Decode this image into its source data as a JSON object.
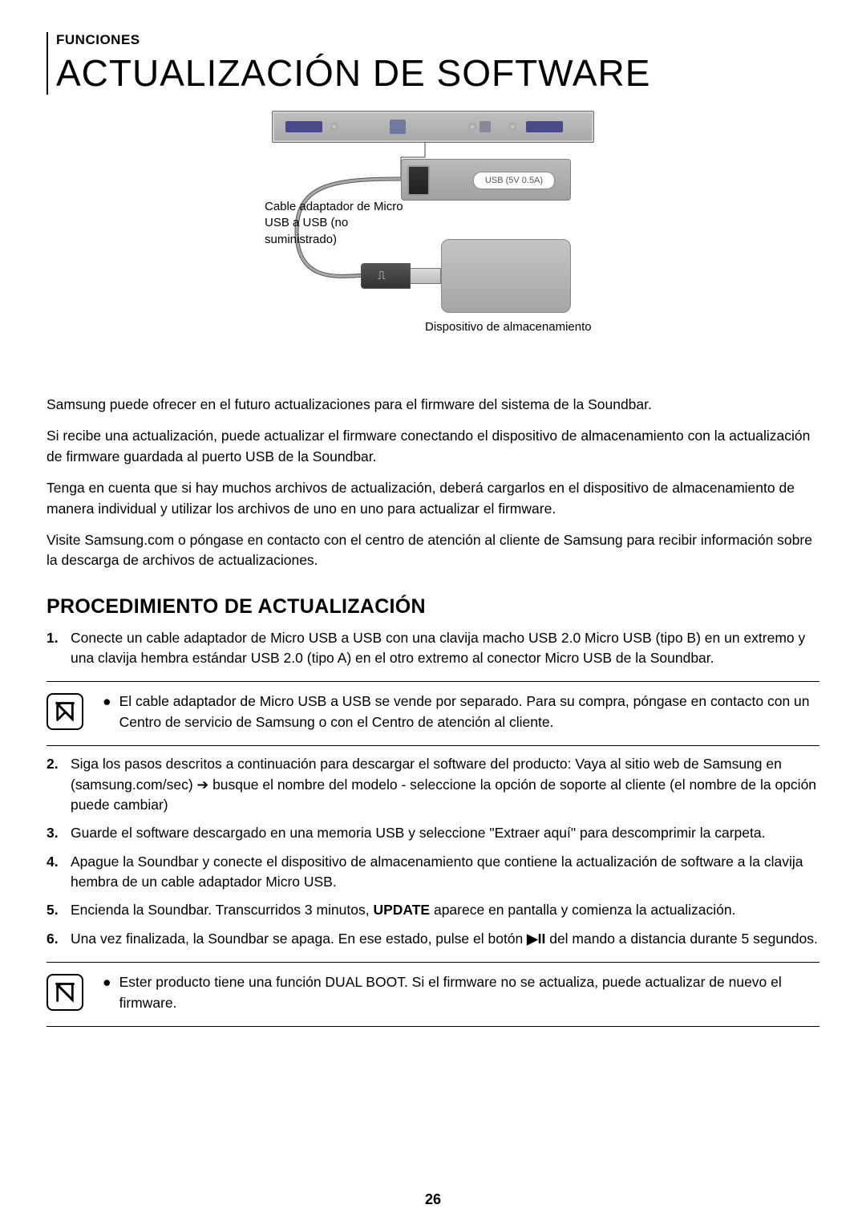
{
  "breadcrumb": "FUNCIONES",
  "title": "ACTUALIZACIÓN DE SOFTWARE",
  "diagram": {
    "usb_port_label": "USB (5V 0.5A)",
    "cable_label": "Cable adaptador de Micro USB a USB (no suministrado)",
    "storage_label": "Dispositivo de almacenamiento"
  },
  "paragraphs": {
    "p1": "Samsung puede ofrecer en el futuro actualizaciones para el firmware del sistema de la Soundbar.",
    "p2": "Si recibe una actualización, puede actualizar el firmware conectando el dispositivo de almacenamiento con la actualización de firmware guardada al puerto USB de la Soundbar.",
    "p3": "Tenga en cuenta que si hay muchos archivos de actualización, deberá cargarlos en el dispositivo de almacenamiento de manera individual y utilizar los archivos de uno en uno para actualizar el firmware.",
    "p4": "Visite Samsung.com o póngase en contacto con el centro de atención al cliente de Samsung para recibir información sobre la descarga de archivos de actualizaciones."
  },
  "subtitle": "PROCEDIMIENTO DE ACTUALIZACIÓN",
  "steps": {
    "s1": "Conecte un cable adaptador de Micro USB a USB con una clavija macho USB 2.0 Micro USB (tipo B) en un extremo y una clavija hembra estándar USB 2.0 (tipo A) en el otro extremo al conector Micro USB de la Soundbar.",
    "s2": "Siga los pasos descritos a continuación para descargar el software del producto: Vaya al sitio web de Samsung en (samsung.com/sec) ➔ busque el nombre del modelo - seleccione la opción de soporte al cliente (el nombre de la opción puede cambiar)",
    "s3": "Guarde el software descargado en una memoria USB y seleccione \"Extraer aquí\" para descomprimir la carpeta.",
    "s4": "Apague la Soundbar y conecte el dispositivo de almacenamiento que contiene la actualización de software a la clavija hembra de un cable adaptador Micro USB.",
    "s5a": "Encienda la Soundbar. Transcurridos 3 minutos, ",
    "s5b": "UPDATE",
    "s5c": " aparece en pantalla y comienza la actualización.",
    "s6a": "Una vez finalizada, la Soundbar se apaga. En ese estado, pulse el botón ",
    "s6b": "▶II",
    "s6c": " del mando a distancia durante 5 segundos."
  },
  "note1": "El cable adaptador de Micro USB a USB se vende por separado. Para su compra, póngase en contacto con un Centro de servicio de Samsung o con el Centro de atención al cliente.",
  "note2": "Ester producto tiene una función DUAL BOOT. Si el firmware no se actualiza, puede actualizar de nuevo el firmware.",
  "page_number": "26"
}
